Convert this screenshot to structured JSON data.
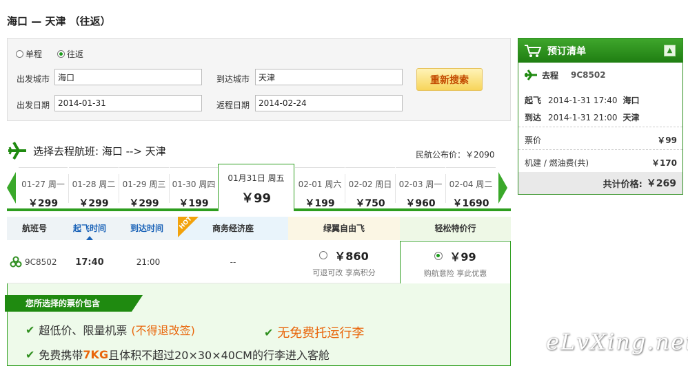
{
  "route_title": "海口 — 天津 （往返）",
  "search": {
    "trip_types": [
      {
        "label": "单程",
        "checked": false
      },
      {
        "label": "往返",
        "checked": true
      }
    ],
    "depart_city_label": "出发城市",
    "depart_city_value": "海口",
    "arrive_city_label": "到达城市",
    "arrive_city_value": "天津",
    "depart_date_label": "出发日期",
    "depart_date_value": "2014-01-31",
    "return_date_label": "返程日期",
    "return_date_value": "2014-02-24",
    "search_button": "重新搜索"
  },
  "order": {
    "title": "预订清单",
    "collapse_icon": "chevron-up-icon",
    "leg_label": "去程",
    "flight_code": "9C8502",
    "takeoff_label": "起飞",
    "takeoff_time": "2014-1-31 17:40",
    "takeoff_city": "海口",
    "arrive_label": "到达",
    "arrive_time": "2014-1-31 21:00",
    "arrive_city": "天津",
    "ticket_label": "票价",
    "ticket_price": "￥99",
    "tax_label": "机建 / 燃油费(共)",
    "tax_price": "￥170",
    "total_label": "共计价格:",
    "total_price": "￥269"
  },
  "select": {
    "heading": "选择去程航班: 海口 --> 天津",
    "official_price": "民航公布价：￥2090"
  },
  "dates": [
    {
      "date": "01-27 周一",
      "price": "￥299"
    },
    {
      "date": "01-28 周二",
      "price": "￥299"
    },
    {
      "date": "01-29 周三",
      "price": "￥299"
    },
    {
      "date": "01-30 周四",
      "price": "￥199"
    },
    {
      "date": "01月31日 周五",
      "price": "￥99",
      "active": true
    },
    {
      "date": "02-01 周六",
      "price": "￥199"
    },
    {
      "date": "02-02 周日",
      "price": "￥750"
    },
    {
      "date": "02-03 周一",
      "price": "￥960"
    },
    {
      "date": "02-04 周二",
      "price": "￥1690"
    }
  ],
  "table": {
    "headers": {
      "flight_no": "航班号",
      "depart_time": "起飞时间",
      "arrive_time": "到达时间",
      "hot": "HOT",
      "business": "商务经济座",
      "green_fare": "绿翼自由飞",
      "easy_fare": "轻松特价行"
    },
    "row": {
      "flight_no": "9C8502",
      "depart": "17:40",
      "arrive": "21:00",
      "business": "--",
      "green_price": "￥860",
      "green_note": "可退可改 享高积分",
      "easy_price": "￥99",
      "easy_note": "购航意险 享此优惠"
    }
  },
  "included": {
    "banner": "您所选择的票价包含",
    "item1_main": "超低价、限量机票",
    "item1_note": "(不得退改签)",
    "item2": "无免费托运行李",
    "item3_a": "免费携带",
    "item3_b": "7KG",
    "item3_c": "且体积不超过20×30×40CM的行李进入客舱"
  },
  "watermark": "eLvXing.net",
  "colors": {
    "brand_green": "#2e9e1f",
    "accent_orange": "#e9650a",
    "link_blue": "#1b63b8"
  }
}
